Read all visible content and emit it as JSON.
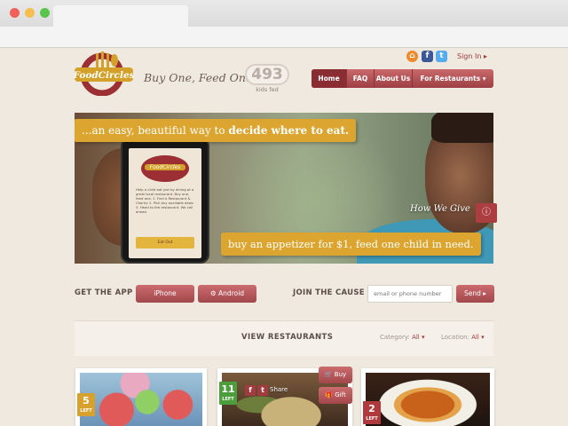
{
  "header": {
    "logo_text": "FoodCircles",
    "tagline": "Buy One, Feed One.",
    "kids_fed_count": "493",
    "kids_fed_label": "kids fed",
    "signin_label": "Sign In ▸",
    "social": {
      "rss": "⌂",
      "facebook": "f",
      "twitter": "t"
    },
    "nav": [
      {
        "label": "Home"
      },
      {
        "label": "FAQ"
      },
      {
        "label": "About Us"
      },
      {
        "label": "For Restaurants ▾"
      }
    ]
  },
  "hero": {
    "banner_top_prefix": "...an easy, beautiful way to ",
    "banner_top_bold": "decide where to eat.",
    "banner_bottom": "buy an appetizer for $1, feed one child in need.",
    "how_we_give": "How We Give",
    "info_icon": "ⓘ",
    "phone": {
      "logo": "FoodCircles",
      "text": "Help a child eat just by dining at a great local restaurant. Buy one, feed one. 1. Find a Restaurant & Charity 2. Pick any available deals 3. Head to the restaurant. We call ahead.",
      "button": "Eat Out"
    }
  },
  "app_row": {
    "get_app_label": "GET THE APP",
    "iphone_label": " iPhone",
    "android_label": "⚙ Android",
    "join_label": "JOIN THE CAUSE",
    "email_placeholder": "email or phone number",
    "send_label": "Send ▸"
  },
  "restaurants": {
    "title": "VIEW RESTAURANTS",
    "category_label": "Category:",
    "category_value": "All ▾",
    "location_label": "Location:",
    "location_value": "All ▾",
    "cards": [
      {
        "left_count": "5",
        "left_label": "LEFT"
      },
      {
        "left_count": "11",
        "left_label": "LEFT",
        "share_label": "Share",
        "buy_label": "🛒 Buy",
        "gift_label": "🎁 Gift"
      },
      {
        "left_count": "2",
        "left_label": "LEFT"
      }
    ]
  },
  "colors": {
    "brand_red": "#a03a3c",
    "brand_gold": "#dba530",
    "page_bg": "#efe9df"
  }
}
